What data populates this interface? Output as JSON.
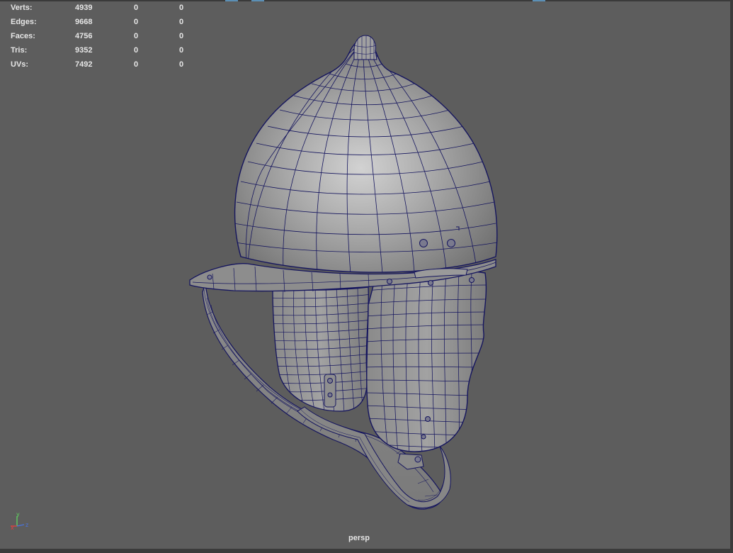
{
  "hud": {
    "rows": [
      {
        "label": "Verts:",
        "total": "4939",
        "selected": "0",
        "component": "0"
      },
      {
        "label": "Edges:",
        "total": "9668",
        "selected": "0",
        "component": "0"
      },
      {
        "label": "Faces:",
        "total": "4756",
        "selected": "0",
        "component": "0"
      },
      {
        "label": "Tris:",
        "total": "9352",
        "selected": "0",
        "component": "0"
      },
      {
        "label": "UVs:",
        "total": "7492",
        "selected": "0",
        "component": "0"
      }
    ]
  },
  "viewport": {
    "camera": "persp",
    "background_color": "#5d5d5d",
    "wire_color": "#15155e",
    "mesh_color": "#9a9a9a"
  },
  "axis": {
    "x": "x",
    "y": "y",
    "z": "z"
  },
  "icons": {
    "axis_gizmo": "axis-gizmo-icon"
  }
}
